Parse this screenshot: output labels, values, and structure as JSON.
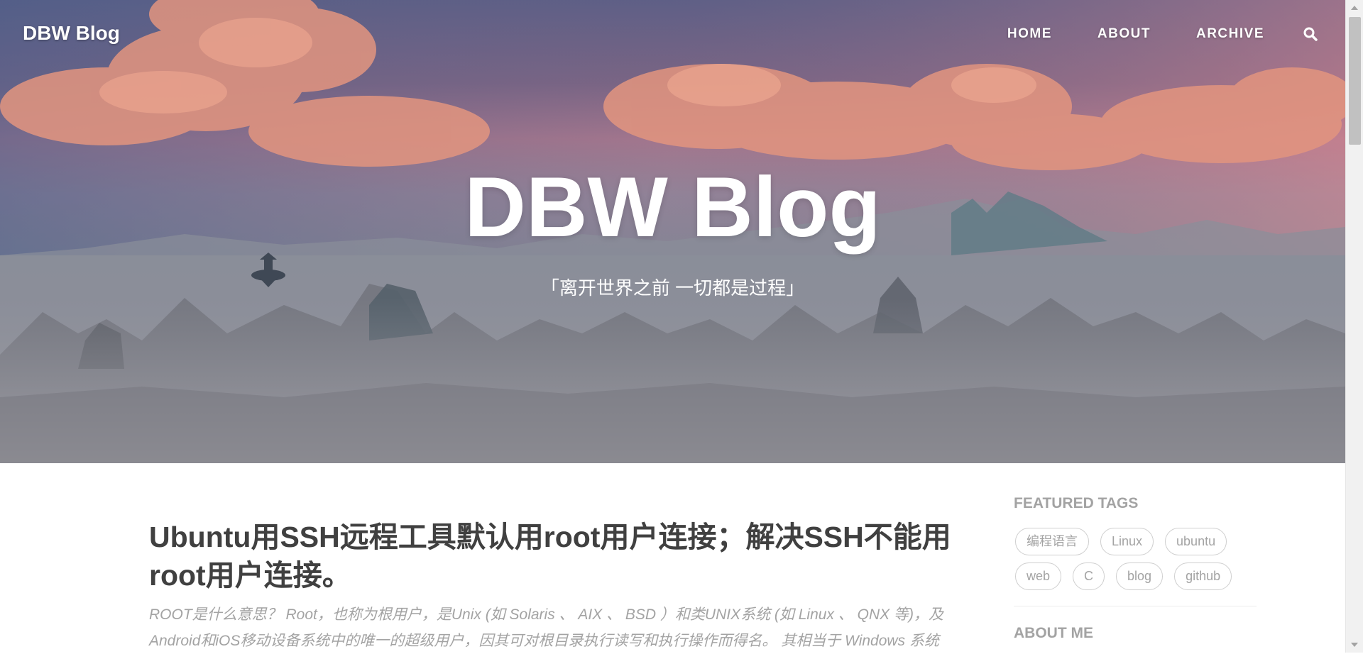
{
  "nav": {
    "brand": "DBW Blog",
    "links": [
      "HOME",
      "ABOUT",
      "ARCHIVE"
    ],
    "search_icon": "search-icon"
  },
  "hero": {
    "title": "DBW Blog",
    "subtitle": "「离开世界之前 一切都是过程」"
  },
  "post": {
    "title": "Ubuntu用SSH远程工具默认用root用户连接；解决SSH不能用root用户连接。",
    "excerpt": "ROOT是什么意思？ Root，也称为根用户，是Unix (如 Solaris 、 AIX 、 BSD ）和类UNIX系统 (如 Linux 、 QNX 等)，及Android和iOS移动设备系统中的唯一的超级用户，因其可对根目录执行读写和执行操作而得名。 其相当于 Windows 系统"
  },
  "sidebar": {
    "featured_tags_heading": "FEATURED TAGS",
    "tags": [
      "编程语言",
      "Linux",
      "ubuntu",
      "web",
      "C",
      "blog",
      "github"
    ],
    "next_heading": "ABOUT ME"
  },
  "colors": {
    "text_dark": "#404040",
    "text_muted": "#a3a3a3",
    "tag_border": "#cfcfcf"
  }
}
